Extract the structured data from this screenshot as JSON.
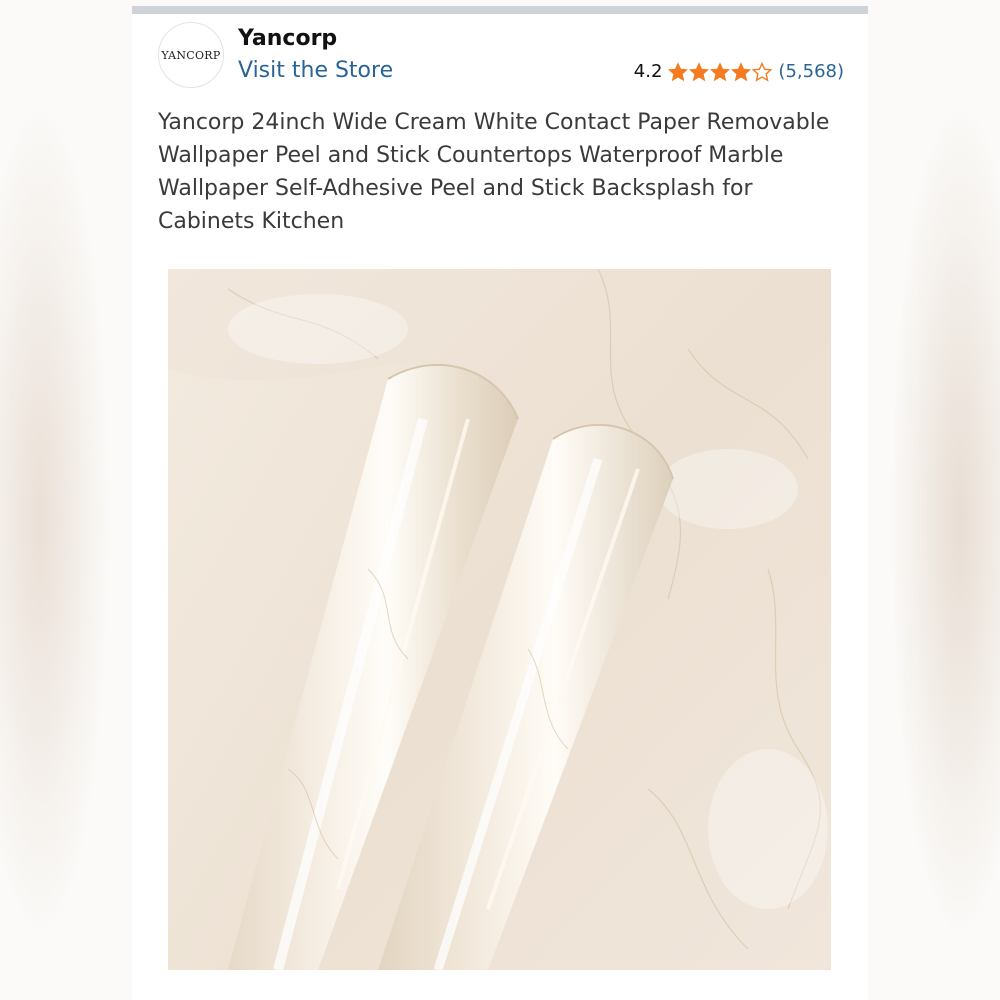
{
  "store": {
    "logo_text": "YANCORP",
    "name": "Yancorp",
    "visit_label": "Visit the Store"
  },
  "rating": {
    "value": "4.2",
    "stars": 4.2,
    "count_label": "(5,568)",
    "star_color": "#f47b20"
  },
  "product": {
    "title": "Yancorp 24inch Wide Cream White Contact Paper Removable Wallpaper Peel and Stick Countertops Waterproof Marble Wallpaper Self-Adhesive Peel and Stick Backsplash for Cabinets Kitchen",
    "image_icon": "marble-contact-paper-rolls"
  },
  "colors": {
    "link": "#2a6496",
    "title_text": "#3a3a3a",
    "marble_base": "#efe4d6"
  }
}
